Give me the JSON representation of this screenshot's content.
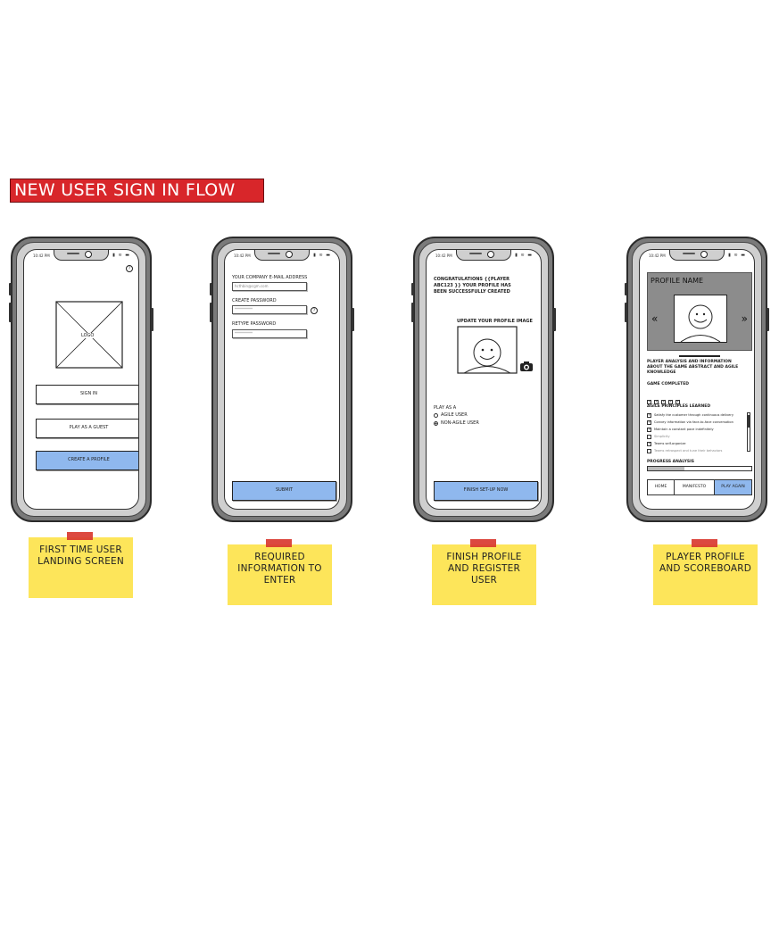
{
  "title": "NEW USER SIGN IN FLOW",
  "status_time": "10:42 PM",
  "status_icons": "▮ ≋ ▬",
  "screen1": {
    "logo": "LOGO",
    "sign_in": "SIGN IN",
    "guest": "PLAY AS A GUEST",
    "create": "CREATE A PROFILE",
    "help": "?"
  },
  "screen2": {
    "email_label": "YOUR COMPANY E-MAIL ADDRESS",
    "email_value": "hcthbin@cgm.com",
    "password_label": "CREATE PASSWORD",
    "password_value": "**********",
    "retype_label": "RETYPE PASSWORD",
    "retype_value": "**********",
    "help": "?",
    "submit": "SUBMIT"
  },
  "screen3": {
    "congrats": "CONGRATULATIONS {{PLAYER ABC123 }} YOUR PROFILE HAS BEEN SUCCESSFULLY CREATED",
    "update_image": "UPDATE YOUR PROFILE IMAGE",
    "play_as": "PLAY AS A",
    "option_agile": "AGILE USER",
    "option_non_agile": "NON-AGILE USER",
    "finish": "FINISH SET-UP NOW"
  },
  "screen4": {
    "profile_name": "PROFILE NAME",
    "prev": "«",
    "next": "»",
    "analysis": "PLAYER ANALYSIS AND INFORMATION ABOUT THE GAME ABSTRACT AND AGILE KNOWLEDGE",
    "game_completed": "GAME COMPLETED",
    "principles_title": "AGILE PRINCIPLES LEARNED",
    "principles": [
      "Satisfy the customer through continuous delivery",
      "Convey information via face-to-face conversation",
      "Maintain a constant pace indefinitely",
      "Simplicity",
      "Teams self-organize",
      "Teams retrospect and tune their behaviors"
    ],
    "principles_checked": [
      true,
      true,
      true,
      false,
      true,
      false
    ],
    "progress_title": "PROGRESS ANALYSIS",
    "progress_fraction": 0.35,
    "tab_home": "HOME",
    "tab_manifesto": "MANIFESTO",
    "tab_play": "PLAY AGAIN"
  },
  "notes": [
    "FIRST TIME USER LANDING SCREEN",
    "REQUIRED INFORMATION TO ENTER",
    "FINISH PROFILE AND REGISTER USER",
    "PLAYER PROFILE AND SCOREBOARD"
  ],
  "colors": {
    "banner": "#d8262a",
    "primary_button": "#8fb8ee",
    "sticky_note": "#fde55a",
    "tape": "#d93a30"
  }
}
